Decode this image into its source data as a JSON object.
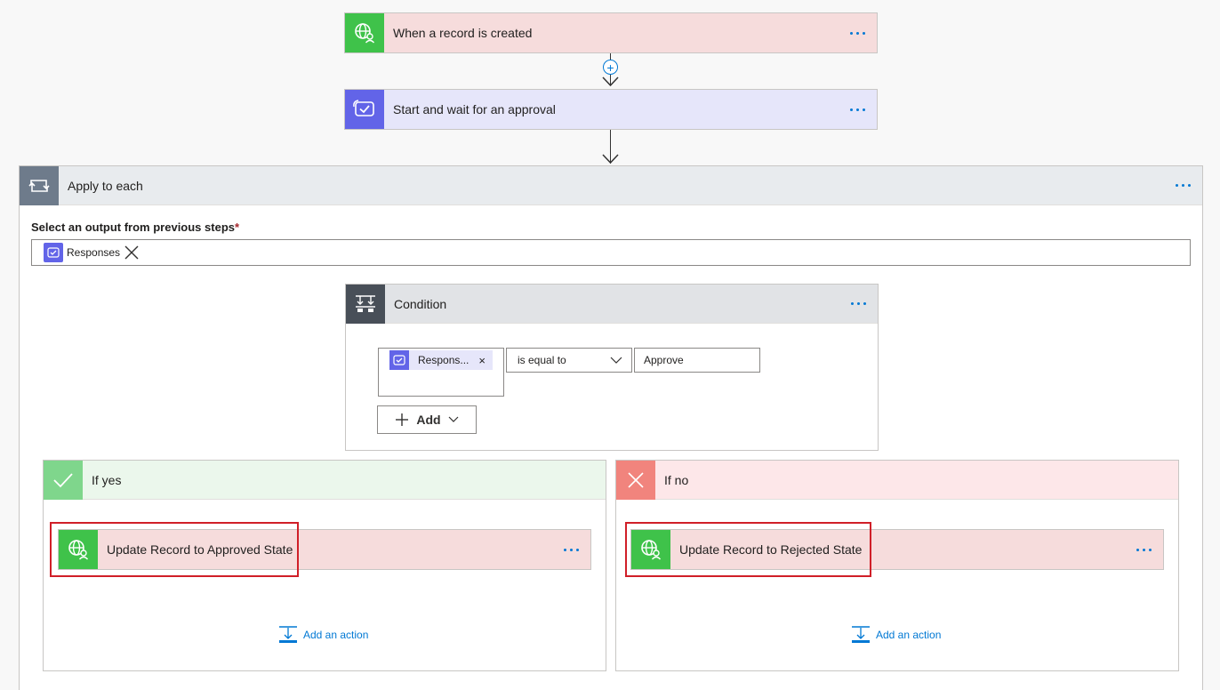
{
  "trigger": {
    "title": "When a record is created",
    "color": "#f6dcdc",
    "icon": "globe-person-icon",
    "icon_bg": "#3fc24a"
  },
  "approval": {
    "title": "Start and wait for an approval",
    "color": "#e6e6fa",
    "icon": "approval-icon",
    "icon_bg": "#6264e8"
  },
  "apply_each": {
    "title": "Apply to each",
    "select_label": "Select an output from previous steps",
    "required_mark": "*",
    "token_label": "Responses"
  },
  "condition": {
    "title": "Condition",
    "left_token": "Respons...",
    "operator": "is equal to",
    "value": "Approve",
    "add_label": "Add"
  },
  "if_yes": {
    "title": "If yes",
    "action_title": "Update Record to Approved State",
    "add_action": "Add an action",
    "header_color": "#ebf7ec",
    "icon_bg": "#7fd68c"
  },
  "if_no": {
    "title": "If no",
    "action_title": "Update Record to Rejected State",
    "add_action": "Add an action",
    "header_color": "#fde7e9",
    "icon_bg": "#f1847d"
  }
}
